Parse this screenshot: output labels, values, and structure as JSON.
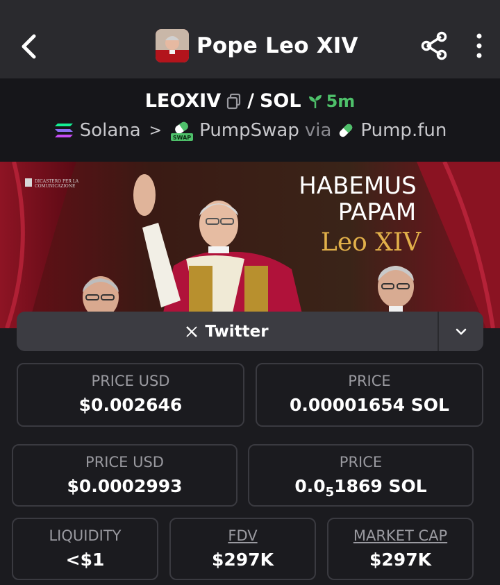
{
  "header": {
    "title": "Pope Leo XIV"
  },
  "pair": {
    "base": "LEOXIV",
    "separator": "/",
    "quote": "SOL",
    "age": "5m"
  },
  "breadcrumbs": {
    "chain": "Solana",
    "dex": "PumpSwap",
    "dex_badge": "SWAP",
    "via_label": "via",
    "launchpad": "Pump.fun"
  },
  "banner": {
    "line1": "HABEMUS",
    "line2": "PAPAM",
    "line3": "Leo XIV",
    "small_text_1": "DICASTERO PER LA",
    "small_text_2": "COMUNICAZIONE"
  },
  "social": {
    "label": "Twitter"
  },
  "stats_row1": [
    {
      "label": "PRICE USD",
      "value": "$0.002646"
    },
    {
      "label": "PRICE",
      "value": "0.00001654 SOL"
    }
  ],
  "stats_row2": [
    {
      "label": "PRICE USD",
      "value": "$0.0002993"
    },
    {
      "label": "PRICE",
      "value_prefix": "0.0",
      "value_sub": "5",
      "value_suffix": "1869 SOL"
    }
  ],
  "stats_row3": [
    {
      "label": "LIQUIDITY",
      "value": "<$1"
    },
    {
      "label": "FDV",
      "value": "$297K"
    },
    {
      "label": "MARKET CAP",
      "value": "$297K"
    }
  ],
  "colors": {
    "accent_green": "#4ec06a",
    "background": "#1b1b1f",
    "header_bg": "#2a2a2e",
    "banner_red": "#7a0f1e"
  }
}
